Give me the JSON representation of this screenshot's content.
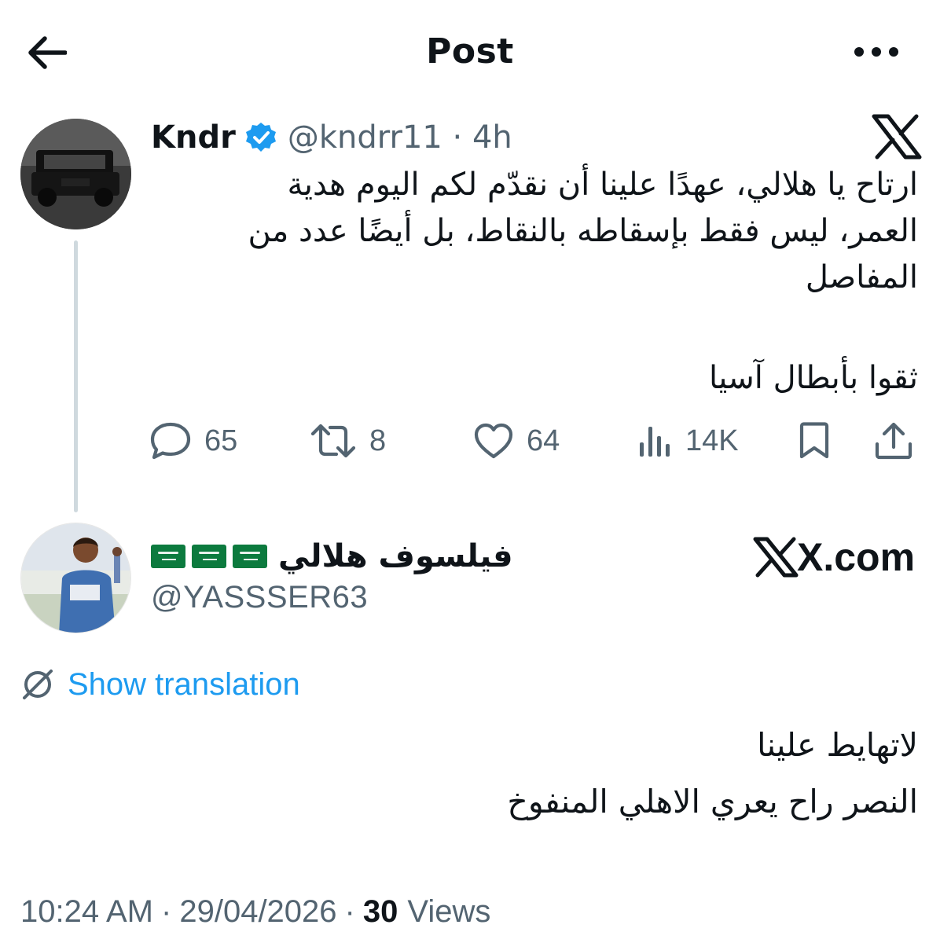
{
  "header": {
    "title": "Post"
  },
  "quoted_tweet": {
    "author_name": "Kndr",
    "handle_time": "@kndrr11 · 4h",
    "text_lines": [
      "ارتاح يا هلالي، عهدًا علينا أن نقدّم لكم اليوم هدية",
      "العمر، ليس فقط بإسقاطه بالنقاط، بل أيضًا عدد من",
      "المفاصل"
    ],
    "tagline": "ثقوا بأبطال آسيا",
    "actions": {
      "replies": "65",
      "reposts": "8",
      "likes": "64",
      "views": "14K"
    }
  },
  "reply_author": {
    "display_name": "فيلسوف هلالي",
    "handle": "@YASSSER63",
    "site_label": "X.com"
  },
  "translation": {
    "label": "Show translation"
  },
  "reply_text_lines": [
    "لاتهايط علينا",
    "النصر راح يعري الاهلي المنفوخ"
  ],
  "meta": {
    "time": "10:24 AM",
    "date": "29/04/2026",
    "views_count": "30",
    "views_label": "Views"
  },
  "colors": {
    "accent": "#1d9bf0",
    "muted": "#536471",
    "text": "#0f1419",
    "thread_line": "#cfd9de"
  }
}
